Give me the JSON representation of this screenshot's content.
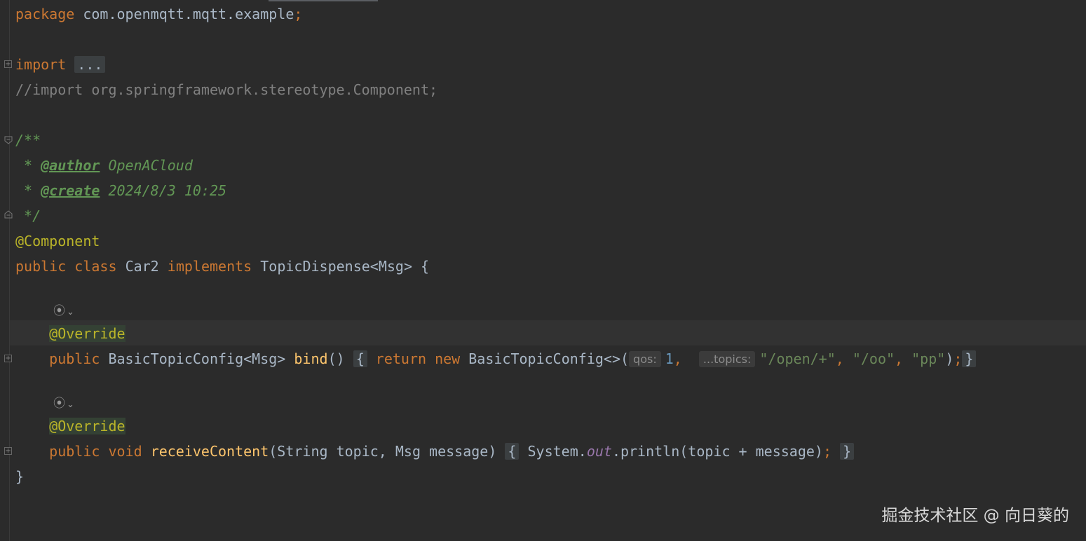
{
  "code": {
    "package_kw": "package",
    "package_name": "com.openmqtt.mqtt.example",
    "package_semi": ";",
    "import_kw": "import",
    "import_fold": "...",
    "commented_import": "//import org.springframework.stereotype.Component;",
    "doc_open": "/**",
    "doc_author_prefix": " * ",
    "doc_author_tag": "@author",
    "doc_author_value": " OpenACloud",
    "doc_create_prefix": " * ",
    "doc_create_tag": "@create",
    "doc_create_value": " 2024/8/3 10:25",
    "doc_close": " */",
    "class_annotation": "@Component",
    "class_kw_public": "public",
    "class_kw_class": "class",
    "class_name": "Car2",
    "class_kw_implements": "implements",
    "class_iface": "TopicDispense<Msg>",
    "class_open": "{",
    "override1": "@Override",
    "m1_public": "public",
    "m1_type": "BasicTopicConfig<Msg>",
    "m1_name": "bind",
    "m1_parens": "()",
    "m1_open": "{",
    "m1_return": "return",
    "m1_new": "new",
    "m1_ctor": "BasicTopicConfig<>(",
    "m1_hint_qos": "qos:",
    "m1_qos_val": "1",
    "m1_comma1": ",",
    "m1_hint_topics": "...topics:",
    "m1_str1": "\"/open/+\"",
    "m1_comma2": ",",
    "m1_str2": "\"/oo\"",
    "m1_comma3": ",",
    "m1_str3": "\"pp\"",
    "m1_close_paren": ")",
    "m1_semi": ";",
    "m1_close": "}",
    "override2": "@Override",
    "m2_public": "public",
    "m2_void": "void",
    "m2_name": "receiveContent",
    "m2_params": "(String topic, Msg message)",
    "m2_open": "{",
    "m2_sys": "System.",
    "m2_out": "out",
    "m2_println": ".println(topic + message)",
    "m2_semi": ";",
    "m2_close": "}",
    "class_close": "}"
  },
  "gutter": {
    "implement_icon_1": "⦿",
    "implement_chevron_1": "⌄",
    "implement_icon_2": "⦿",
    "implement_chevron_2": "⌄"
  },
  "watermark": "掘金技术社区 @ 向日葵的"
}
